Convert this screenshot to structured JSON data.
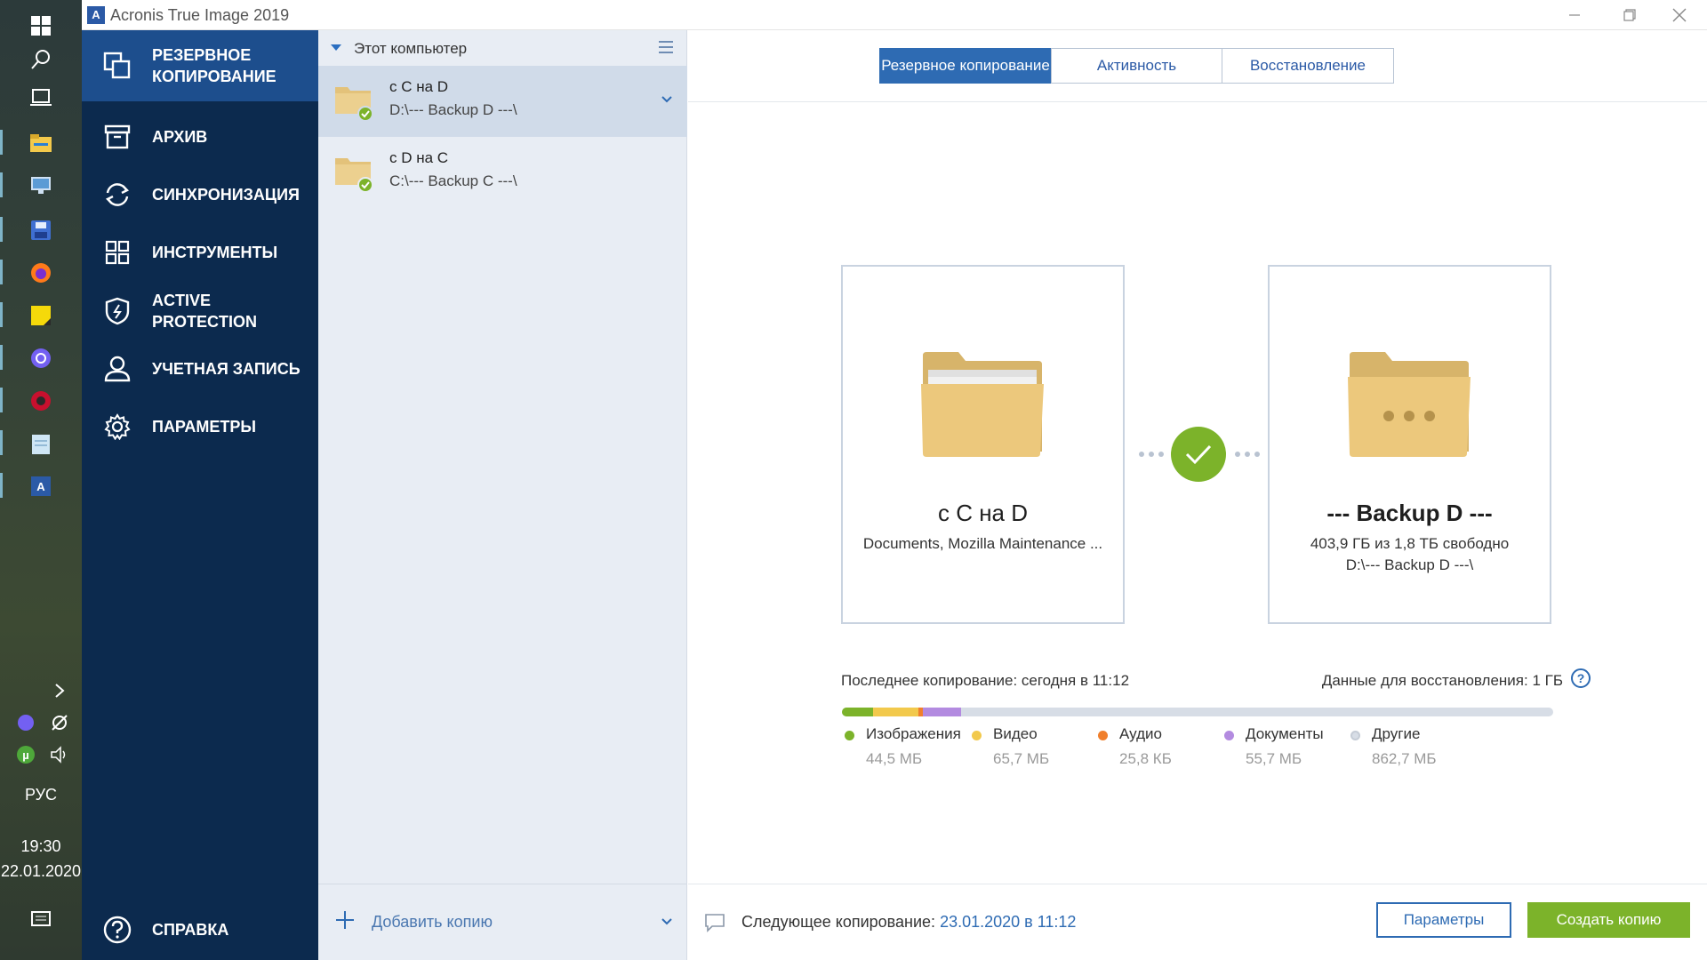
{
  "taskbar": {
    "language": "РУС",
    "time": "19:30",
    "date": "22.01.2020",
    "icons": [
      "windows-start-icon",
      "search-icon",
      "task-view-icon",
      "file-explorer-icon",
      "remote-desktop-icon",
      "floppy-save-icon",
      "firefox-icon",
      "sticky-notes-icon",
      "viber-icon",
      "media-app-icon",
      "notepad-icon",
      "acronis-icon"
    ],
    "tray_icons": [
      "show-hidden-icons-chevron",
      "viber-tray-icon",
      "network-tray-icon",
      "utorrent-tray-icon",
      "volume-tray-icon",
      "notifications-icon"
    ]
  },
  "window": {
    "title": "Acronis True Image 2019",
    "logo_letter": "A"
  },
  "nav": {
    "items": [
      {
        "label": "РЕЗЕРВНОЕ КОПИРОВАНИЕ",
        "icon": "backup-icon"
      },
      {
        "label": "АРХИВ",
        "icon": "archive-box-icon"
      },
      {
        "label": "СИНХРОНИЗАЦИЯ",
        "icon": "sync-icon"
      },
      {
        "label": "ИНСТРУМЕНТЫ",
        "icon": "tools-grid-icon"
      },
      {
        "label": "ACTIVE PROTECTION",
        "icon": "shield-icon"
      },
      {
        "label": "УЧЕТНАЯ ЗАПИСЬ",
        "icon": "account-user-icon"
      },
      {
        "label": "ПАРАМЕТРЫ",
        "icon": "settings-gear-icon"
      }
    ],
    "help": {
      "label": "СПРАВКА",
      "icon": "help-question-icon"
    }
  },
  "backups": {
    "header": "Этот компьютер",
    "items": [
      {
        "title": "с С на D",
        "path": "D:\\--- Backup D ---\\"
      },
      {
        "title": "с D на С",
        "path": "C:\\--- Backup C ---\\"
      }
    ],
    "add_label": "Добавить копию"
  },
  "tabs": [
    "Резервное копирование",
    "Активность",
    "Восстановление"
  ],
  "source": {
    "title": "с С на D",
    "subtitle": "Documents, Mozilla Maintenance ..."
  },
  "destination": {
    "title": "--- Backup D ---",
    "free": "403,9 ГБ из 1,8 ТБ свободно",
    "path": "D:\\--- Backup D ---\\"
  },
  "status": {
    "last_copy": "Последнее копирование: сегодня в 11:12",
    "recovery_data": "Данные для восстановления: 1 ГБ",
    "help_glyph": "?"
  },
  "usage": {
    "total_mb": 1028.7,
    "categories": [
      {
        "name": "Изображения",
        "size": "44,5 МБ",
        "mb": 44.5,
        "color": "#7cb32a"
      },
      {
        "name": "Видео",
        "size": "65,7 МБ",
        "mb": 65.7,
        "color": "#f2c94c"
      },
      {
        "name": "Аудио",
        "size": "25,8 КБ",
        "mb": 0.0258,
        "color": "#f07f2c"
      },
      {
        "name": "Документы",
        "size": "55,7 МБ",
        "mb": 55.7,
        "color": "#b38be0"
      },
      {
        "name": "Другие",
        "size": "862,7 МБ",
        "mb": 862.7,
        "color": "#d7dde6"
      }
    ]
  },
  "bottom": {
    "next_copy_label": "Следующее копирование:",
    "next_copy_date": "23.01.2020 в 11:12",
    "params_button": "Параметры",
    "create_button": "Создать копию"
  },
  "colors": {
    "nav_bg": "#0c2a4e",
    "nav_active": "#1d4e8d",
    "accent_blue": "#2e6bb3",
    "success_green": "#7cb32a",
    "folder_yellow": "#e8c97a"
  }
}
